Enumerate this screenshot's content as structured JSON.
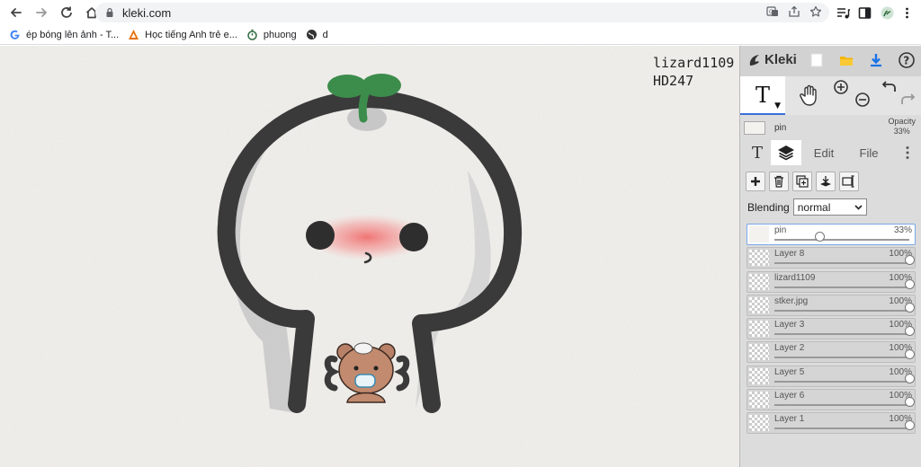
{
  "browser": {
    "url": "kleki.com",
    "bookmarks": [
      {
        "label": "ép bóng lên ảnh - T...",
        "icon": "google-icon"
      },
      {
        "label": "Học tiếng Anh trẻ e...",
        "icon": "triangle-logo-icon"
      },
      {
        "label": "phuong",
        "icon": "stopwatch-icon"
      },
      {
        "label": "d",
        "icon": "globe-icon"
      }
    ]
  },
  "canvas": {
    "signature_line1": "lizard1109",
    "signature_line2": "HD247"
  },
  "app": {
    "name": "Kleki",
    "active_tool": "T",
    "selected_layer_name": "pin",
    "opacity_label": "Opacity",
    "opacity_value": "33%",
    "tabs": {
      "text_tab": "T",
      "edit": "Edit",
      "file": "File"
    },
    "blending_label": "Blending",
    "blending_value": "normal",
    "layers": [
      {
        "name": "pin",
        "opacity": "33%",
        "level": 0.33,
        "selected": true
      },
      {
        "name": "Layer 8",
        "opacity": "100%",
        "level": 1.0,
        "selected": false
      },
      {
        "name": "lizard1109",
        "opacity": "100%",
        "level": 1.0,
        "selected": false
      },
      {
        "name": "stker.jpg",
        "opacity": "100%",
        "level": 1.0,
        "selected": false
      },
      {
        "name": "Layer 3",
        "opacity": "100%",
        "level": 1.0,
        "selected": false
      },
      {
        "name": "Layer 2",
        "opacity": "100%",
        "level": 1.0,
        "selected": false
      },
      {
        "name": "Layer 5",
        "opacity": "100%",
        "level": 1.0,
        "selected": false
      },
      {
        "name": "Layer 6",
        "opacity": "100%",
        "level": 1.0,
        "selected": false
      },
      {
        "name": "Layer 1",
        "opacity": "100%",
        "level": 1.0,
        "selected": false
      }
    ]
  },
  "colors": {
    "accent": "#3b6fd6",
    "download": "#1a73e8",
    "folder": "#f4b400",
    "outline": "#3a3a3a",
    "sprout": "#3c8c4c"
  }
}
